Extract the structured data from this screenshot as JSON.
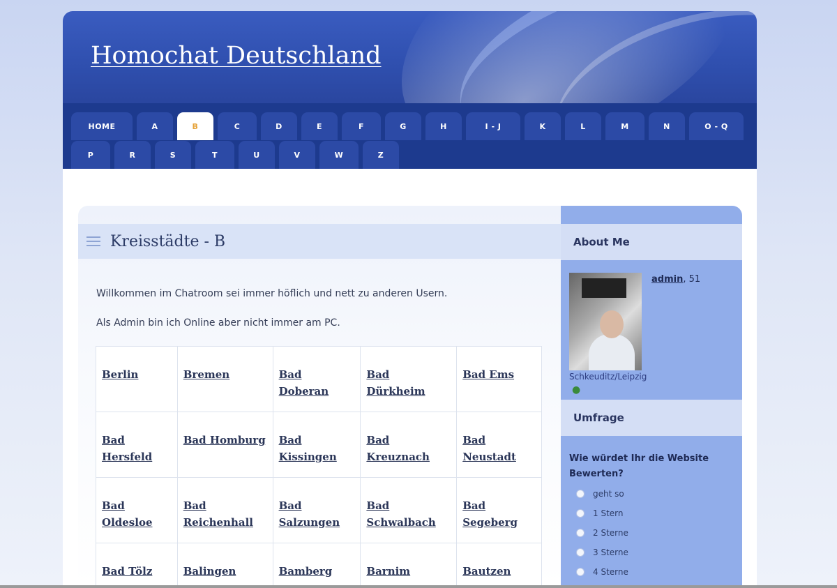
{
  "site": {
    "title": "Homochat Deutschland"
  },
  "nav": {
    "row1": [
      "HOME",
      "A",
      "B",
      "C",
      "D",
      "E",
      "F",
      "G",
      "H",
      "I - J",
      "K",
      "L",
      "M",
      "N",
      "O - Q"
    ],
    "row2": [
      "P",
      "R",
      "S",
      "T",
      "U",
      "V",
      "W",
      "Z"
    ],
    "active": "B"
  },
  "main": {
    "section_title": "Kreisstädte - B",
    "intro": [
      "Willkommen im Chatroom sei immer höflich und nett zu anderen Usern.",
      "Als Admin bin ich Online aber nicht immer am PC."
    ],
    "cities": [
      [
        "Berlin",
        "Bremen",
        "Bad Doberan",
        "Bad Dürkheim",
        "Bad Ems"
      ],
      [
        "Bad Hersfeld",
        "Bad Homburg",
        "Bad Kissingen",
        "Bad Kreuznach",
        "Bad Neustadt"
      ],
      [
        "Bad Oldesloe",
        "Bad Reichenhall",
        "Bad Salzungen",
        "Bad Schwalbach",
        "Bad Segeberg"
      ],
      [
        "Bad Tölz",
        "Balingen",
        "Bamberg",
        "Barnim",
        "Bautzen"
      ]
    ]
  },
  "sidebar": {
    "about": {
      "title": "About Me",
      "user": "admin",
      "age": ", 51",
      "location": "Schkeuditz/Leipzig"
    },
    "poll": {
      "title": "Umfrage",
      "question": "Wie würdet Ihr die Website Bewerten?",
      "options": [
        "geht so",
        "1 Stern",
        "2 Sterne",
        "3 Sterne",
        "4 Sterne"
      ]
    }
  },
  "colors": {
    "header": "#2f4fae",
    "nav": "#1d3a8e",
    "sidebar": "#91adea",
    "active_tab_text": "#e6a33a"
  }
}
